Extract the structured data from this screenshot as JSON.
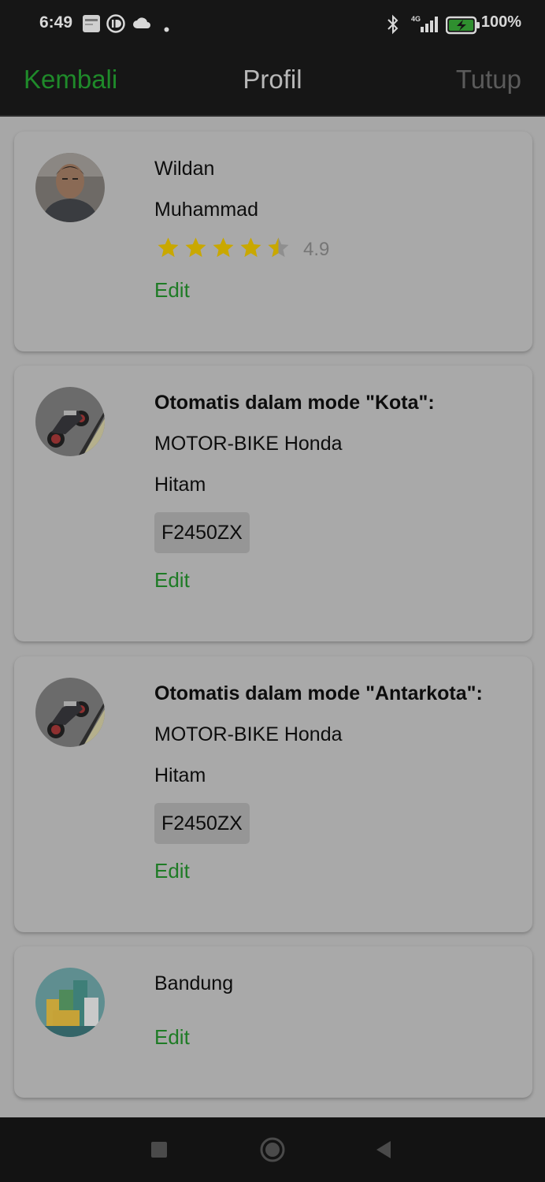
{
  "status_bar": {
    "time": "6:49",
    "battery": "100%",
    "network": "4G",
    "icons": [
      "gallery-icon",
      "id-icon",
      "cloud-icon",
      "dot-icon",
      "bluetooth-icon",
      "signal-icon",
      "battery-charging-icon"
    ]
  },
  "app_bar": {
    "back_label": "Kembali",
    "title": "Profil",
    "close_label": "Tutup"
  },
  "profile": {
    "first_name": "Wildan",
    "last_name": "Muhammad",
    "rating": 4.9,
    "rating_text": "4.9",
    "edit_label": "Edit"
  },
  "vehicles": [
    {
      "mode_label": "Otomatis dalam mode \"Kota\":",
      "model": "MOTOR-BIKE Honda",
      "color": "Hitam",
      "plate": "F2450ZX",
      "edit_label": "Edit"
    },
    {
      "mode_label": "Otomatis dalam mode \"Antarkota\":",
      "model": "MOTOR-BIKE Honda",
      "color": "Hitam",
      "plate": "F2450ZX",
      "edit_label": "Edit"
    }
  ],
  "city": {
    "name": "Bandung",
    "edit_label": "Edit"
  },
  "colors": {
    "accent_green": "#1f8a2a",
    "star_yellow": "#c9a800",
    "dim_overlay_bg": "#a7a7a7"
  }
}
